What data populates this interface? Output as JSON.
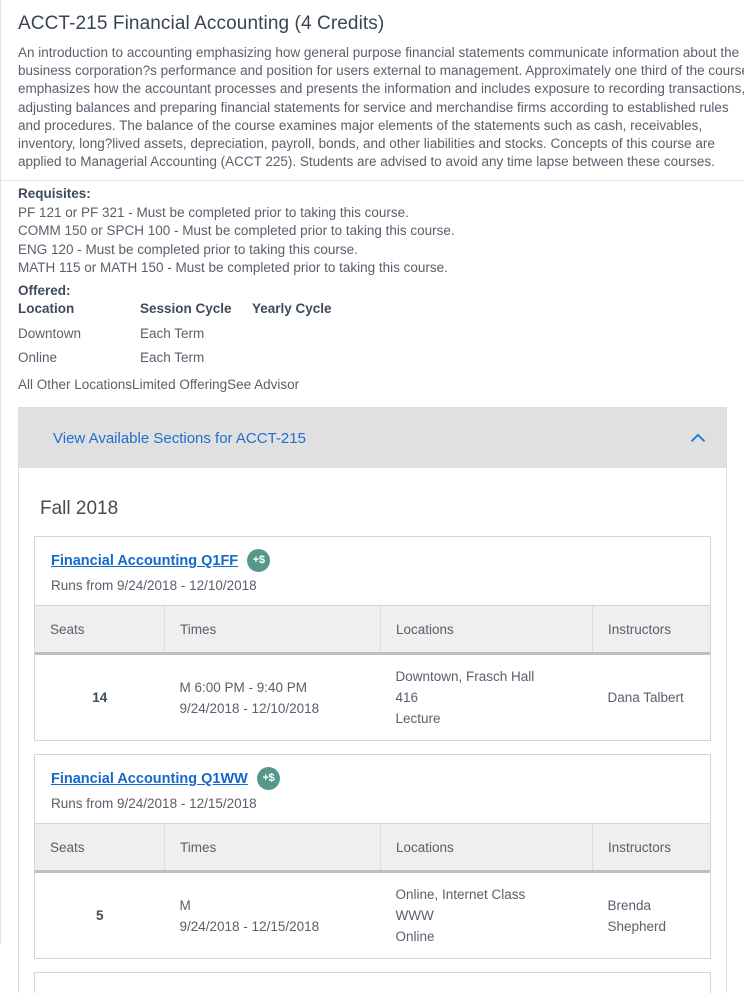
{
  "course": {
    "title": "ACCT-215 Financial Accounting (4 Credits)",
    "description": "An introduction to accounting emphasizing how general purpose financial statements communicate information about the business corporation?s performance and position for users external to management. Approximately one third of the course emphasizes how the accountant processes and presents the information and includes exposure to recording transactions, adjusting balances and preparing financial statements for service and merchandise firms according to established rules and procedures. The balance of the course examines major elements of the statements such as cash, receivables, inventory, long?lived assets, depreciation, payroll, bonds, and other liabilities and stocks. Concepts of this course are applied to Managerial Accounting (ACCT 225). Students are advised to avoid any time lapse between these courses."
  },
  "requisites": {
    "label": "Requisites:",
    "lines": [
      "PF 121 or PF 321 - Must be completed prior to taking this course.",
      "COMM 150 or SPCH 100 - Must be completed prior to taking this course.",
      "ENG 120 - Must be completed prior to taking this course.",
      "MATH 115 or MATH 150 - Must be completed prior to taking this course."
    ]
  },
  "offered": {
    "label": "Offered:",
    "headers": [
      "Location",
      "Session Cycle",
      "Yearly Cycle"
    ],
    "rows": [
      [
        "Downtown",
        "Each Term",
        ""
      ],
      [
        "Online",
        "Each Term",
        ""
      ]
    ],
    "note": "All Other LocationsLimited OfferingSee Advisor"
  },
  "accordion": {
    "label": "View Available Sections for ACCT-215",
    "chevron": "chevron-up-icon",
    "expanded": true,
    "link_color": "#1f6fd0",
    "header_bg": "#e0e0e0"
  },
  "term": {
    "title": "Fall 2018"
  },
  "table_headers": [
    "Seats",
    "Times",
    "Locations",
    "Instructors"
  ],
  "badge": {
    "text": "+$",
    "name": "additional-fee-icon",
    "color": "#54998c"
  },
  "sections": [
    {
      "name": "Financial Accounting Q1FF",
      "has_fee_badge": true,
      "runs": "Runs from 9/24/2018 - 12/10/2018",
      "rows": [
        {
          "seats": "14",
          "times": [
            "M 6:00 PM - 9:40 PM",
            "9/24/2018 - 12/10/2018"
          ],
          "locations": [
            "Downtown, Frasch Hall",
            "416",
            "Lecture"
          ],
          "instructors": "Dana Talbert"
        }
      ]
    },
    {
      "name": "Financial Accounting Q1WW",
      "has_fee_badge": true,
      "runs": "Runs from 9/24/2018 - 12/15/2018",
      "rows": [
        {
          "seats": "5",
          "times": [
            "M",
            "9/24/2018 - 12/15/2018"
          ],
          "locations": [
            "Online, Internet Class",
            "WWW",
            "Online"
          ],
          "instructors": "Brenda Shepherd"
        }
      ]
    }
  ]
}
